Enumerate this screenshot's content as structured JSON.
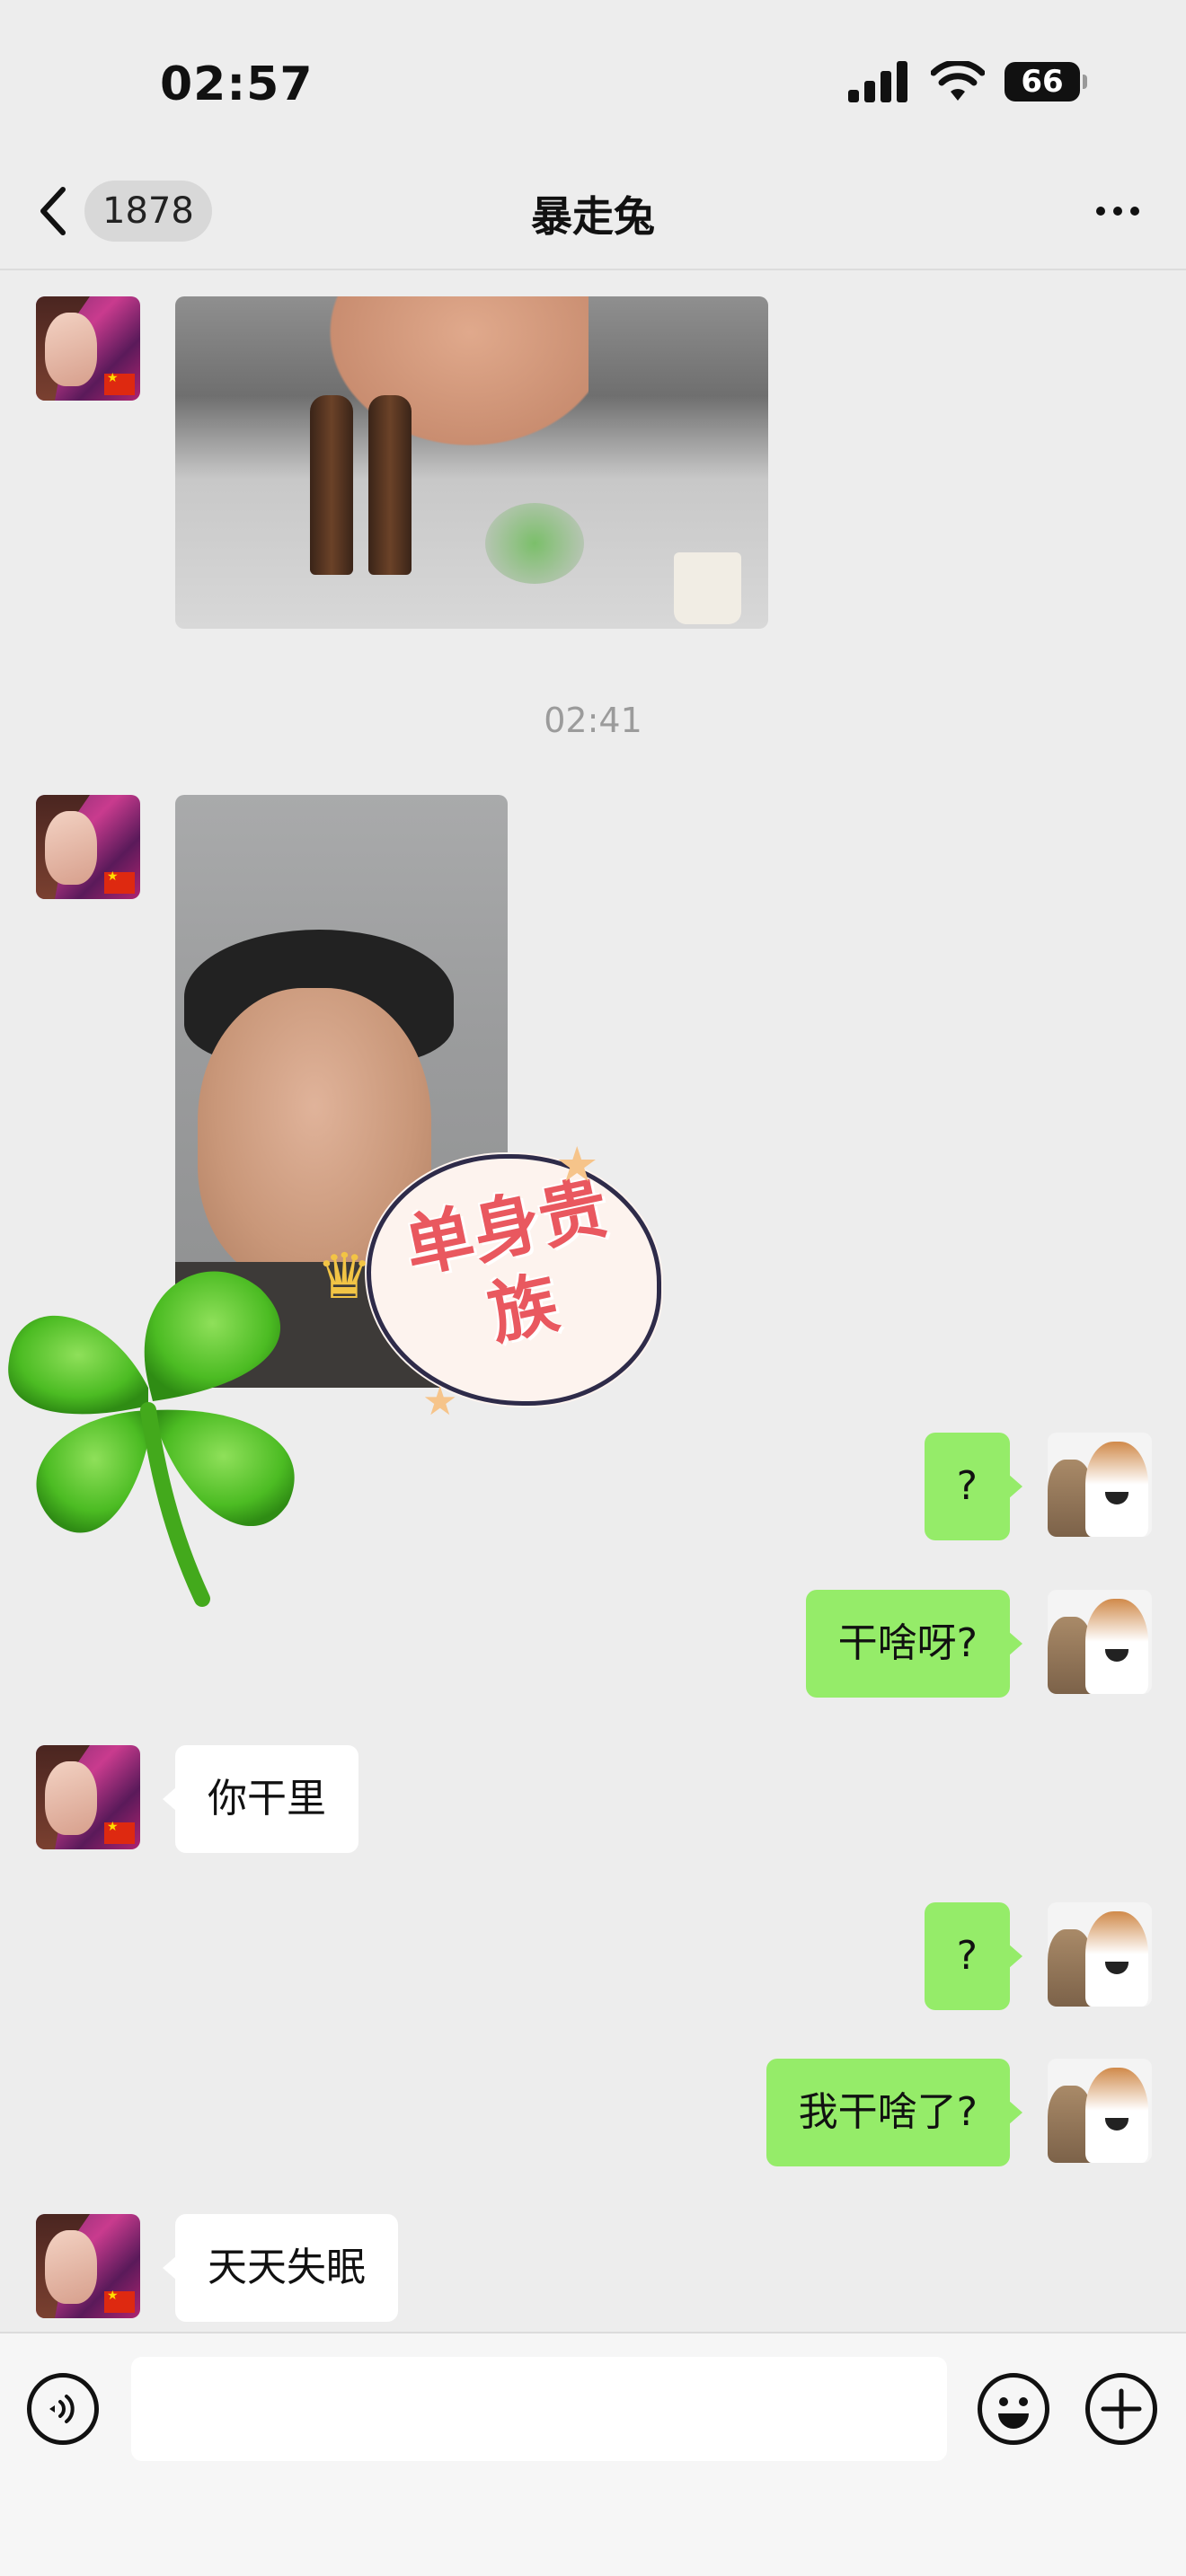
{
  "status_bar": {
    "time": "02:57",
    "battery": "66"
  },
  "nav": {
    "unread_count": "1878",
    "title": "暴走兔",
    "more_icon": "more-dots-icon"
  },
  "messages": {
    "timestamp": "02:41",
    "sticker_text": "单身贵族",
    "out_1": "?",
    "out_2": "干啥呀?",
    "in_1": "你干里",
    "out_3": "?",
    "out_4": "我干啥了?",
    "in_2": "天天失眠"
  },
  "input_bar": {
    "voice_icon": "voice-icon",
    "emoji_icon": "emoji-icon",
    "plus_icon": "plus-icon",
    "placeholder": ""
  },
  "colors": {
    "background": "#ededed",
    "bubble_out": "#95ec69",
    "bubble_in": "#ffffff",
    "sticker_text": "#e9585f"
  }
}
